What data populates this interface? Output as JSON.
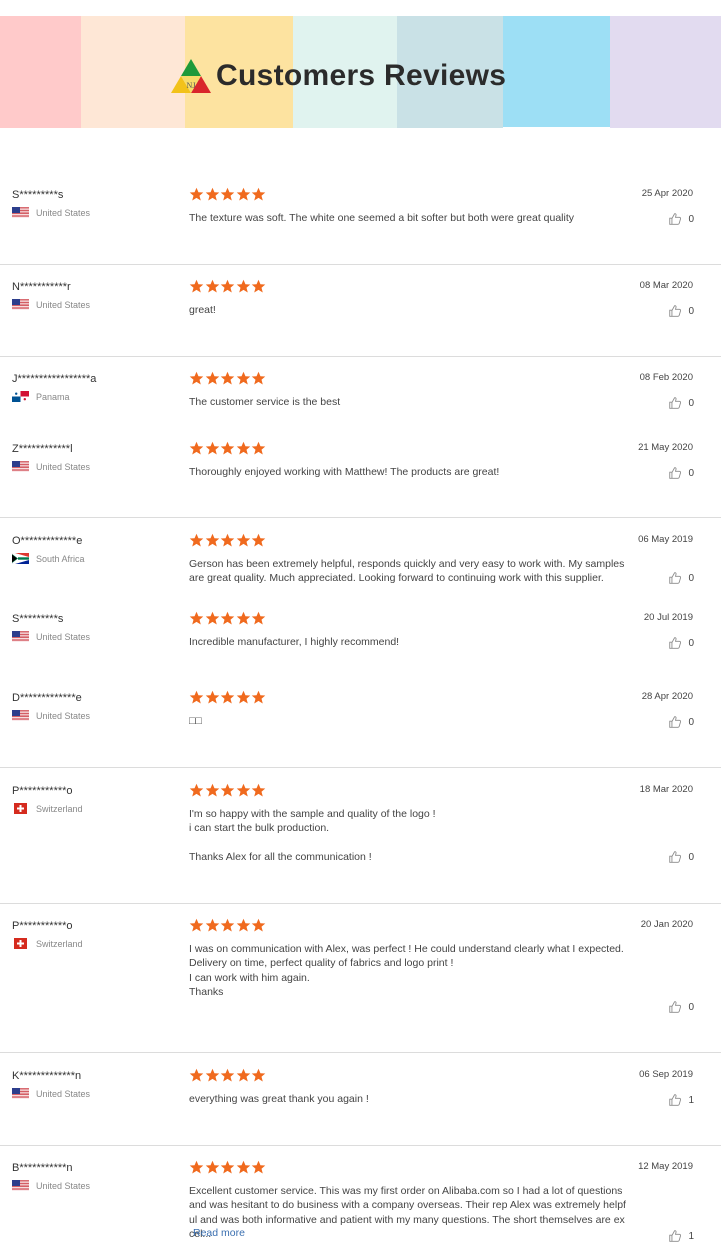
{
  "banner": {
    "title": "Customers Reviews",
    "logo_text": "NJ",
    "stripe_colors": [
      "#ffcaca",
      "#fee7d6",
      "#fde3a0",
      "#e0f3ef",
      "#c9e1e6",
      "#9ddff5",
      "#e2dbf0"
    ]
  },
  "review_ui": {
    "rating_max": 5,
    "star_color": "#f06a1e",
    "thumb_icon": "thumbs-up-icon"
  },
  "reviews": [
    {
      "name": "S*********s",
      "country": "United States",
      "flag": "us",
      "rating": 5,
      "date": "25 Apr 2020",
      "text": "The texture was soft. The white one seemed a bit softer but both were great quality",
      "likes": "0"
    },
    {
      "name": "N***********r",
      "country": "United States",
      "flag": "us",
      "rating": 5,
      "date": "08 Mar 2020",
      "text": "great!",
      "likes": "0"
    },
    {
      "name": "J*****************a",
      "country": "Panama",
      "flag": "pa",
      "rating": 5,
      "date": "08 Feb 2020",
      "text": "The customer service is the best",
      "likes": "0"
    },
    {
      "name": "Z************l",
      "country": "United States",
      "flag": "us",
      "rating": 5,
      "date": "21 May 2020",
      "text": "Thoroughly enjoyed working with Matthew! The products are great!",
      "likes": "0"
    },
    {
      "name": "O*************e",
      "country": "South Africa",
      "flag": "za",
      "rating": 5,
      "date": "06 May 2019",
      "text": "Gerson has been extremely helpful, responds quickly and very easy to work with. My samples are great quality. Much appreciated. Looking forward to continuing work with this supplier.",
      "likes": "0"
    },
    {
      "name": "S*********s",
      "country": "United States",
      "flag": "us",
      "rating": 5,
      "date": "20 Jul 2019",
      "text": "Incredible manufacturer, I highly recommend!",
      "likes": "0"
    },
    {
      "name": "D*************e",
      "country": "United States",
      "flag": "us",
      "rating": 5,
      "date": "28 Apr 2020",
      "text": "□□",
      "likes": "0"
    },
    {
      "name": "P***********o",
      "country": "Switzerland",
      "flag": "ch",
      "rating": 5,
      "date": "18 Mar 2020",
      "text": "I'm so happy with the sample and quality of the logo !\ni can start the bulk production.\n\nThanks Alex for all the communication !",
      "likes": "0"
    },
    {
      "name": "P***********o",
      "country": "Switzerland",
      "flag": "ch",
      "rating": 5,
      "date": "20 Jan 2020",
      "text": "I was on communication with Alex, was perfect ! He could understand clearly what I expected.\nDelivery on time, perfect quality of fabrics and logo print !\nI can work with him again.\nThanks",
      "likes": "0"
    },
    {
      "name": "K*************n",
      "country": "United States",
      "flag": "us",
      "rating": 5,
      "date": "06 Sep 2019",
      "text": "everything was great thank you again !",
      "likes": "1"
    },
    {
      "name": "B***********n",
      "country": "United States",
      "flag": "us",
      "rating": 5,
      "date": "12 May 2019",
      "text": "Excellent customer service. This was my first order on Alibaba.com so I had a lot of questions and was hesitant to do business with a company overseas. Their rep Alex was extremely helpful and was both informative and patient with my many questions. The short themselves are excel...",
      "likes": "1",
      "read_more": "Read more"
    }
  ]
}
